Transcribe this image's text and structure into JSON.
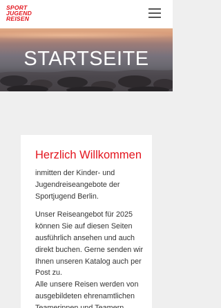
{
  "header": {
    "logo_lines": [
      "SPORT",
      "JUGEND",
      "REISEN"
    ],
    "menu_icon": "hamburger-menu-icon"
  },
  "hero": {
    "title": "STARTSEITE"
  },
  "welcome": {
    "title": "Herzlich Willkommen",
    "paragraphs": [
      "inmitten der Kinder- und Jugendreiseangebote der Sportjugend Berlin.",
      "Unser Reiseangebot für 2025 können Sie auf diesen Seiten ausführlich ansehen und auch direkt buchen. Gerne senden wir Ihnen unseren Katalog auch per Post zu.",
      "Alle unsere Reisen werden von ausgebildeten ehrenamtlichen Teamerinnen und Teamern"
    ]
  },
  "colors": {
    "brand_red": "#e3141d",
    "page_background": "#efefef"
  }
}
